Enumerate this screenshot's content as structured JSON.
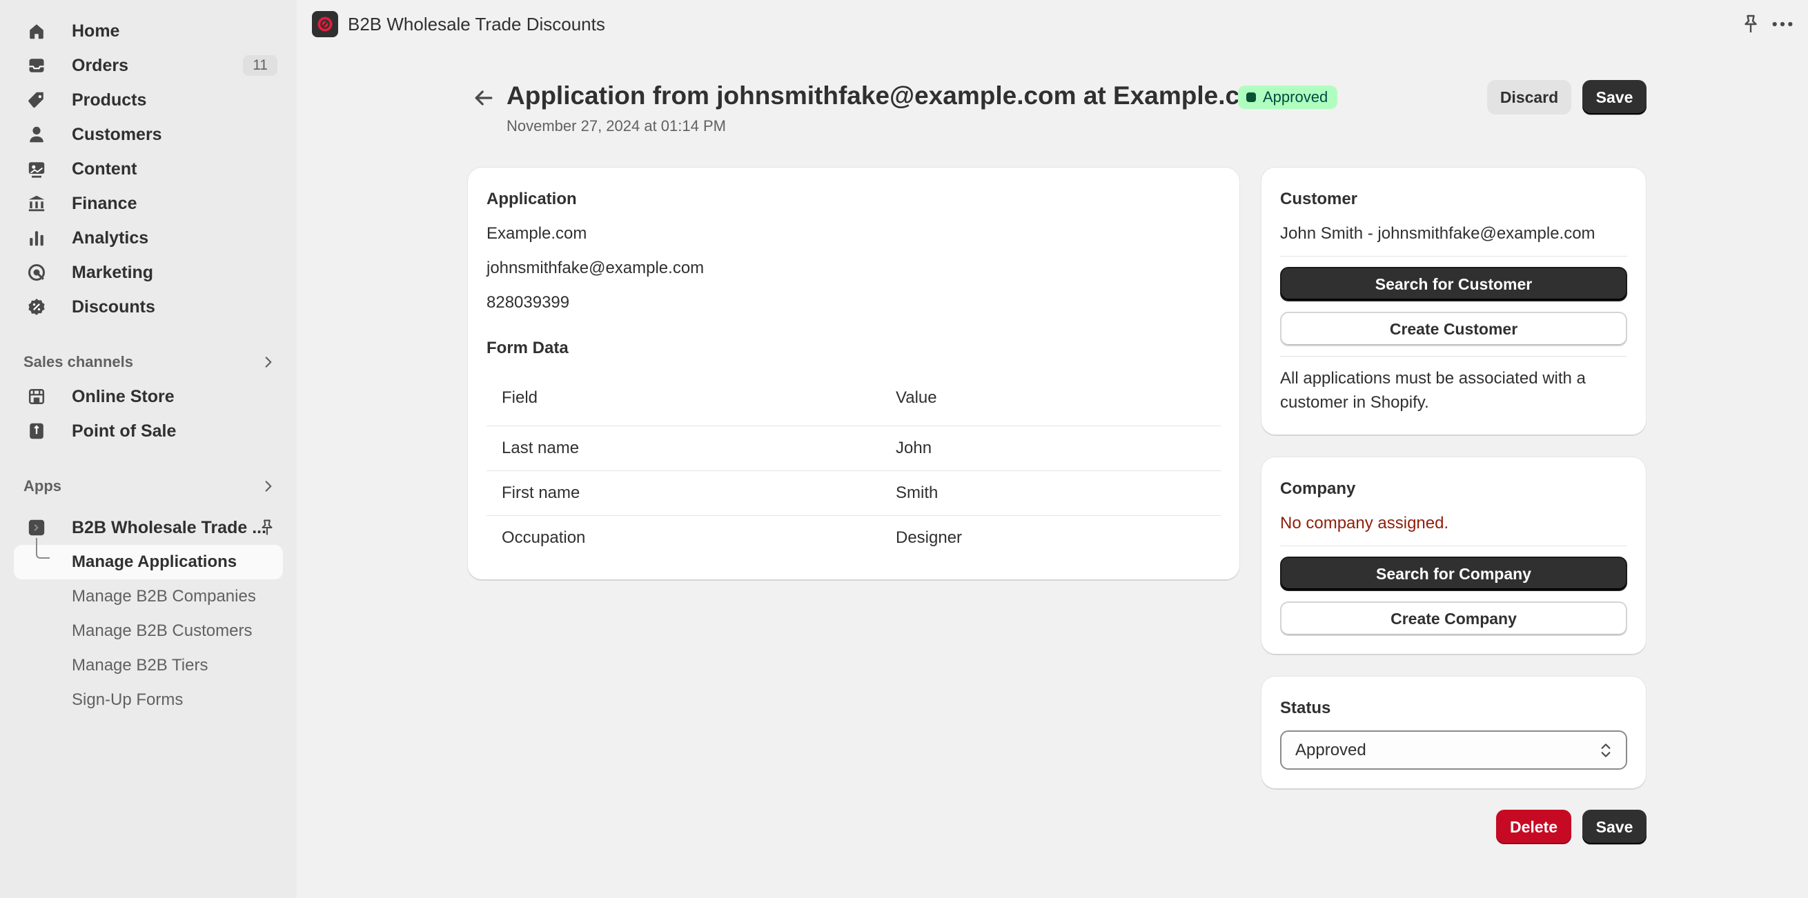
{
  "sidebar": {
    "items": [
      {
        "label": "Home",
        "icon": "home-icon"
      },
      {
        "label": "Orders",
        "icon": "orders-icon",
        "badge": "11"
      },
      {
        "label": "Products",
        "icon": "tag-icon"
      },
      {
        "label": "Customers",
        "icon": "person-icon"
      },
      {
        "label": "Content",
        "icon": "content-icon"
      },
      {
        "label": "Finance",
        "icon": "bank-icon"
      },
      {
        "label": "Analytics",
        "icon": "bar-chart-icon"
      },
      {
        "label": "Marketing",
        "icon": "target-icon"
      },
      {
        "label": "Discounts",
        "icon": "discount-icon"
      }
    ],
    "sales_channels": {
      "heading": "Sales channels",
      "items": [
        {
          "label": "Online Store",
          "icon": "store-icon"
        },
        {
          "label": "Point of Sale",
          "icon": "pos-icon"
        }
      ]
    },
    "apps": {
      "heading": "Apps",
      "app_name": "B2B Wholesale Trade ...",
      "sub_items": [
        {
          "label": "Manage Applications",
          "active": true
        },
        {
          "label": "Manage B2B Companies"
        },
        {
          "label": "Manage B2B Customers"
        },
        {
          "label": "Manage B2B Tiers"
        },
        {
          "label": "Sign-Up Forms"
        }
      ]
    }
  },
  "topbar": {
    "app_title": "B2B Wholesale Trade Discounts"
  },
  "header": {
    "title": "Application from johnsmithfake@example.com at Example.com",
    "status": "Approved",
    "date": "November 27, 2024 at 01:14 PM",
    "discard_label": "Discard",
    "save_label": "Save"
  },
  "application": {
    "title": "Application",
    "company": "Example.com",
    "email": "johnsmithfake@example.com",
    "phone": "828039399",
    "form_data_title": "Form Data",
    "columns": [
      "Field",
      "Value"
    ],
    "rows": [
      {
        "field": "Last name",
        "value": "John"
      },
      {
        "field": "First name",
        "value": "Smith"
      },
      {
        "field": "Occupation",
        "value": "Designer"
      }
    ]
  },
  "customer": {
    "title": "Customer",
    "name": "John Smith - johnsmithfake@example.com",
    "search_label": "Search for Customer",
    "create_label": "Create Customer",
    "note_line1": "All applications must be associated with a",
    "note_line2": "customer in Shopify."
  },
  "company": {
    "title": "Company",
    "none_text": "No company assigned.",
    "search_label": "Search for Company",
    "create_label": "Create Company"
  },
  "status_card": {
    "title": "Status",
    "selected": "Approved"
  },
  "footer": {
    "delete_label": "Delete",
    "save_label": "Save"
  },
  "colors": {
    "accent_dark": "#303030",
    "danger": "#c70a24",
    "badge_success_bg": "#affebf",
    "error_text": "#8e0b21"
  }
}
